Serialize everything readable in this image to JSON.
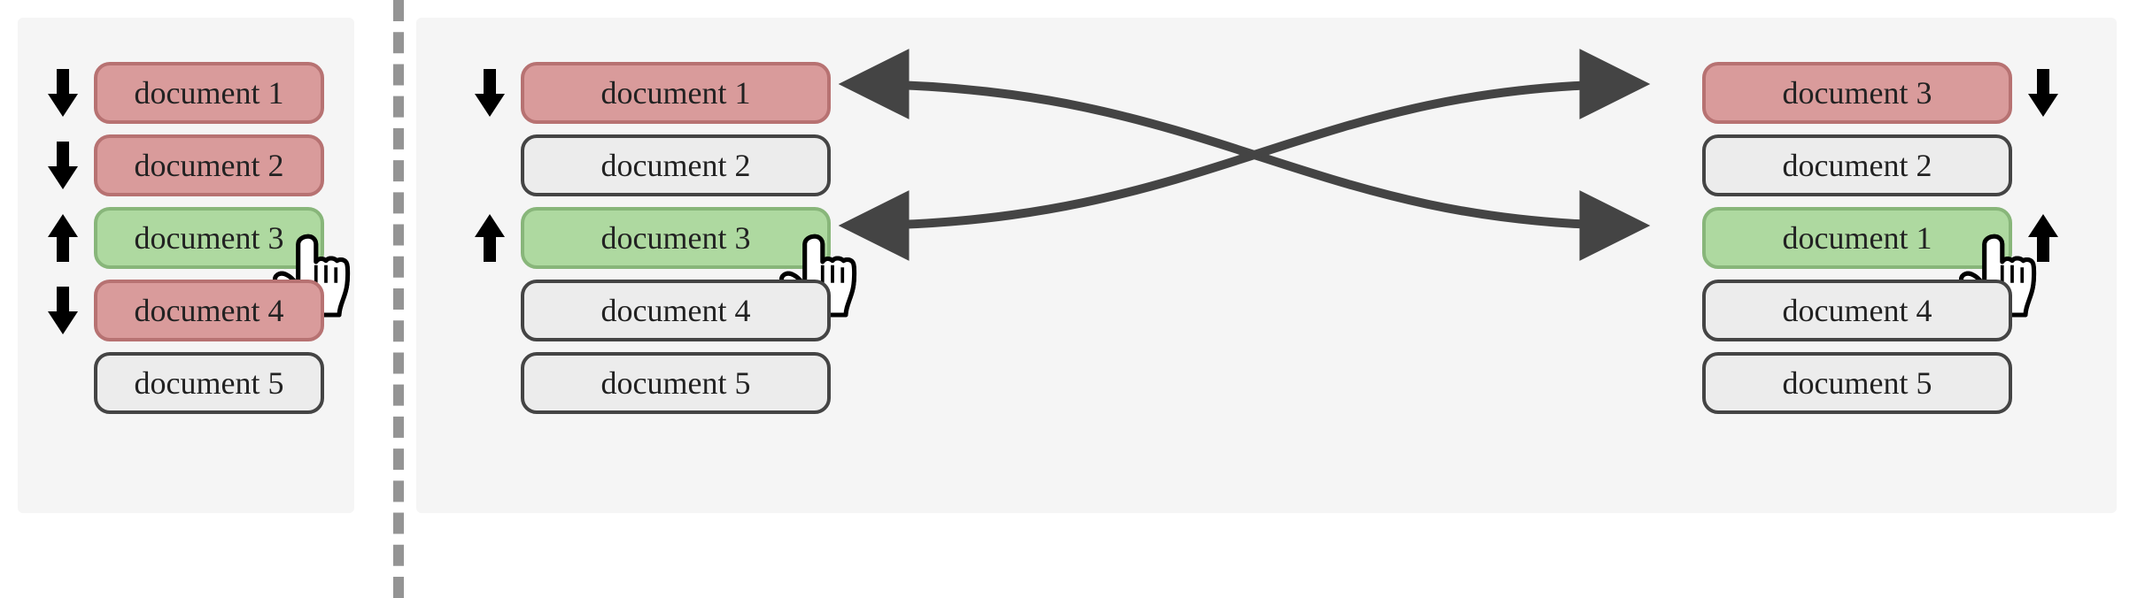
{
  "colors": {
    "red_fill": "#d99b9b",
    "red_stroke": "#b77272",
    "green_fill": "#aed9a0",
    "green_stroke": "#88b67a",
    "gray_fill": "#ececec",
    "outline": "#444444",
    "panel_bg": "#f5f5f5",
    "divider": "#949494"
  },
  "icons": {
    "arrow_down": "arrow-down-icon",
    "arrow_up": "arrow-up-icon",
    "pointer_hand": "hand-cursor-icon",
    "swap_arrows": "swap-arrows-icon"
  },
  "left_panel": {
    "items": [
      {
        "label": "document 1",
        "state": "red",
        "vote": "down"
      },
      {
        "label": "document 2",
        "state": "red",
        "vote": "down"
      },
      {
        "label": "document 3",
        "state": "green",
        "vote": "up",
        "cursor": true
      },
      {
        "label": "document 4",
        "state": "red",
        "vote": "down"
      },
      {
        "label": "document 5",
        "state": "gray",
        "vote": null
      }
    ]
  },
  "right_panel": {
    "before": {
      "items": [
        {
          "label": "document 1",
          "state": "red",
          "vote": "down"
        },
        {
          "label": "document 2",
          "state": "gray",
          "vote": null
        },
        {
          "label": "document 3",
          "state": "green",
          "vote": "up",
          "cursor": true
        },
        {
          "label": "document 4",
          "state": "gray",
          "vote": null
        },
        {
          "label": "document 5",
          "state": "gray",
          "vote": null
        }
      ]
    },
    "after": {
      "items": [
        {
          "label": "document 3",
          "state": "red",
          "vote": "down"
        },
        {
          "label": "document 2",
          "state": "gray",
          "vote": null
        },
        {
          "label": "document 1",
          "state": "green",
          "vote": "up",
          "cursor": true
        },
        {
          "label": "document 4",
          "state": "gray",
          "vote": null
        },
        {
          "label": "document 5",
          "state": "gray",
          "vote": null
        }
      ]
    },
    "swap": {
      "from_index": 0,
      "to_index": 2
    }
  }
}
